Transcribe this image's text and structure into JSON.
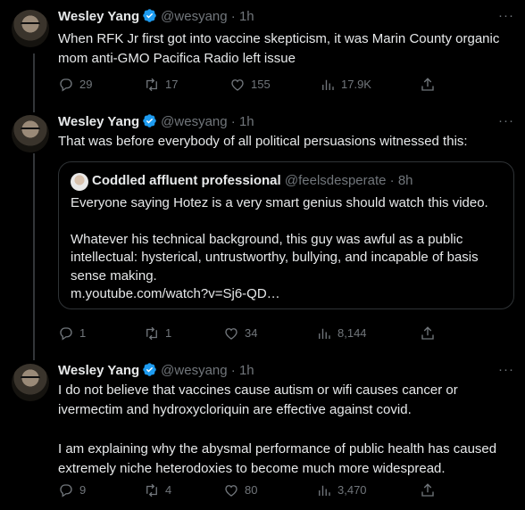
{
  "tweets": [
    {
      "name": "Wesley Yang",
      "handle": "@wesyang",
      "time": "1h",
      "text": "When RFK Jr first got into vaccine skepticism, it was Marin County organic mom anti-GMO Pacifica Radio left issue",
      "replies": "29",
      "retweets": "17",
      "likes": "155",
      "views": "17.9K"
    },
    {
      "name": "Wesley Yang",
      "handle": "@wesyang",
      "time": "1h",
      "text": "That was before everybody of all political persuasions witnessed this:",
      "quote": {
        "name": "Coddled affluent professional",
        "handle": "@feelsdesperate",
        "time": "8h",
        "line1": "Everyone saying Hotez is a very smart genius should watch this video.",
        "line2": "Whatever his technical background, this guy was awful as a public intellectual: hysterical, untrustworthy, bullying, and incapable of basis sense making.",
        "link": "m.youtube.com/watch?v=Sj6-QD…"
      },
      "replies": "1",
      "retweets": "1",
      "likes": "34",
      "views": "8,144"
    },
    {
      "name": "Wesley Yang",
      "handle": "@wesyang",
      "time": "1h",
      "para1": "I do not believe that vaccines cause autism or wifi causes cancer or ivermectim and hydroxycloriquin are effective against covid.",
      "para2": "I am explaining why the abysmal performance of public health has caused extremely niche heterodoxies to become much more widespread.",
      "replies": "9",
      "retweets": "4",
      "likes": "80",
      "views": "3,470"
    }
  ],
  "separator": "·",
  "more": "···",
  "colors": {
    "background": "#000000",
    "text": "#e7e9ea",
    "muted": "#71767b",
    "verified": "#1d9bf0",
    "border": "#2f3336"
  },
  "icons": [
    "reply-icon",
    "retweet-icon",
    "like-icon",
    "views-icon",
    "share-icon",
    "verified-badge-icon",
    "more-icon"
  ]
}
